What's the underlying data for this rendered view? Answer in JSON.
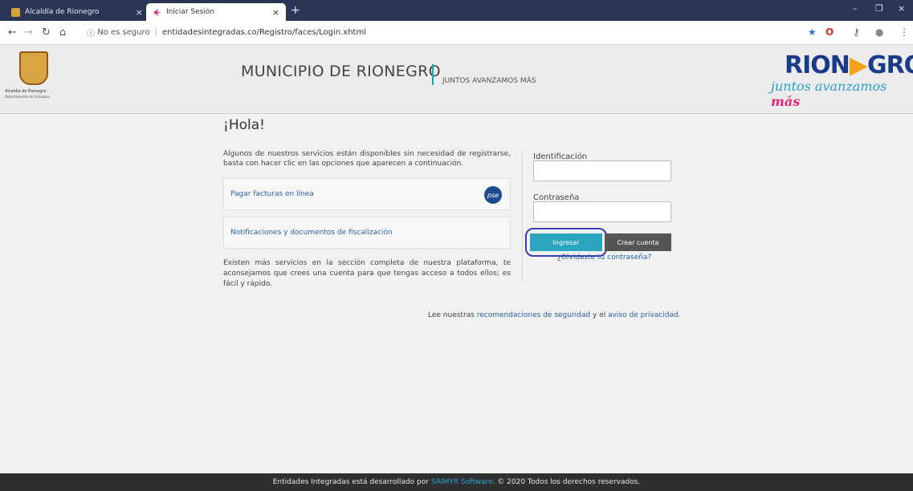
{
  "browser": {
    "tabs": [
      {
        "title": "Alcaldía de Rionegro",
        "close": "×"
      },
      {
        "title": "Iniciar Sesión",
        "close": "×"
      }
    ],
    "new_tab": "+",
    "window_controls": {
      "minimize": "–",
      "maximize": "❐",
      "close": "×"
    },
    "security_label": "No es seguro",
    "url": "entidadesintegradas.co/Registro/faces/Login.xhtml"
  },
  "header": {
    "crest_caption": "Alcaldía de Rionegro",
    "crest_subcaption": "Departamento de Antioquia",
    "brand": "MUNICIPIO DE RIONEGRO",
    "slogan": "JUNTOS AVANZAMOS MÁS",
    "logo_left": "RION",
    "logo_right": "GRO",
    "logo_sub": "juntos avanzamos",
    "logo_sub_mas": "más"
  },
  "main": {
    "greeting": "¡Hola!",
    "intro": "Algunos de nuestros servicios están disponibles sin necesidad de registrarse, basta con hacer clic en las opciones que aparecen a continuación.",
    "options": [
      {
        "label": "Pagar facturas en línea",
        "badge": "pse"
      },
      {
        "label": "Notificaciones y documentos de fiscalización"
      }
    ],
    "more_text": "Existen más servicios en la sección completa de nuestra plataforma, te aconsejamos que crees una cuenta para que tengas acceso a todos ellos; es fácil y rápido."
  },
  "login": {
    "id_label": "Identificación",
    "password_label": "Contraseña",
    "login_button": "Ingresar",
    "create_button": "Crear cuenta",
    "forgot_link": "¿Olvidaste tu contraseña?"
  },
  "security": {
    "prefix": "Lee nuestras",
    "link1": "recomendaciones de seguridad",
    "middle": "y el",
    "link2": "aviso de privacidad",
    "suffix": "."
  },
  "footer": {
    "prefix": "Entidades Integradas está desarrollado por",
    "link": "SAIMYR Software",
    "suffix": ". © 2020 Todos los derechos reservados."
  }
}
